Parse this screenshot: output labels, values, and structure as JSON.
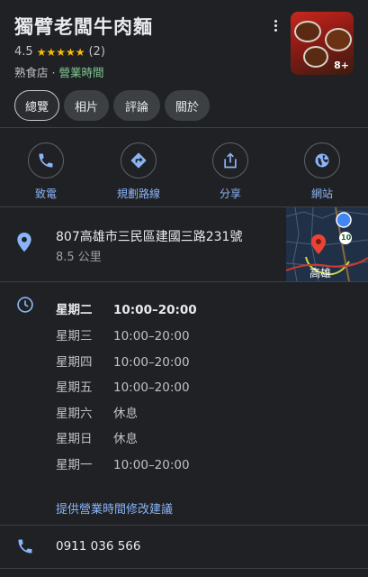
{
  "place": {
    "name": "獨臂老闆牛肉麵",
    "rating": "4.5",
    "stars": "★★★★★",
    "review_count": "(2)",
    "category": "熟食店",
    "separator": " · ",
    "hours_status": "營業時間",
    "photo_count": "8+"
  },
  "tabs": [
    {
      "label": "總覽"
    },
    {
      "label": "相片"
    },
    {
      "label": "評論"
    },
    {
      "label": "關於"
    }
  ],
  "actions": [
    {
      "label": "致電",
      "icon": "phone-icon"
    },
    {
      "label": "規劃路線",
      "icon": "directions-icon"
    },
    {
      "label": "分享",
      "icon": "share-icon"
    },
    {
      "label": "網站",
      "icon": "globe-icon"
    }
  ],
  "address": {
    "line": "807高雄市三民區建國三路231號",
    "distance": "8.5 公里",
    "map_label": "高雄",
    "map_badge": "10"
  },
  "hours": [
    {
      "day": "星期二",
      "time": "10:00–20:00"
    },
    {
      "day": "星期三",
      "time": "10:00–20:00"
    },
    {
      "day": "星期四",
      "time": "10:00–20:00"
    },
    {
      "day": "星期五",
      "time": "10:00–20:00"
    },
    {
      "day": "星期六",
      "time": "休息"
    },
    {
      "day": "星期日",
      "time": "休息"
    },
    {
      "day": "星期一",
      "time": "10:00–20:00"
    }
  ],
  "suggest_hours": "提供營業時間修改建議",
  "phone": "0911 036 566",
  "colors": {
    "background": "#202124",
    "accent": "#8ab4f8",
    "open_green": "#81c995",
    "star_yellow": "#fbbc04"
  }
}
